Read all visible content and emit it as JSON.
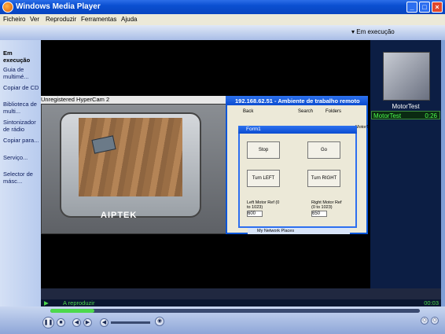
{
  "window": {
    "title": "Windows Media Player"
  },
  "menu": [
    "Ficheiro",
    "Ver",
    "Reproduzir",
    "Ferramentas",
    "Ajuda"
  ],
  "now_playing_label": "Em execução",
  "nav": [
    {
      "label": "Em execução"
    },
    {
      "label": "Guia de multimé..."
    },
    {
      "label": "Copiar de CD"
    },
    {
      "label": "Biblioteca de multi..."
    },
    {
      "label": "Sintonizador de rádio"
    },
    {
      "label": "Copiar para..."
    },
    {
      "label": "Serviço..."
    },
    {
      "label": "Selector de másc..."
    }
  ],
  "playlist": {
    "title": "MotorTest",
    "items": [
      {
        "name": "MotorTest",
        "duration": "0:26"
      }
    ]
  },
  "status": {
    "text": "A reproduzir",
    "time": "00:03"
  },
  "video": {
    "hypercam_title": "Unregistered HyperCam 2",
    "camera_brand": "AIPTEK",
    "rd_title": "192.168.62.51 - Ambiente de trabalho remoto",
    "toolbar": {
      "back": "Back",
      "search": "Search",
      "folders": "Folders",
      "motortest": "MotorTest"
    },
    "form": {
      "title": "Form1",
      "stop": "Stop",
      "go": "Go",
      "left": "Turn LEFT",
      "right": "Turn RIGHT",
      "left_label": "Left Motor Ref (0 to 1023)",
      "right_label": "Right Motor Ref (0 to 1023)",
      "left_value": "600",
      "right_value": "650"
    },
    "network": "My Network Places"
  },
  "seek_progress": 0.12
}
